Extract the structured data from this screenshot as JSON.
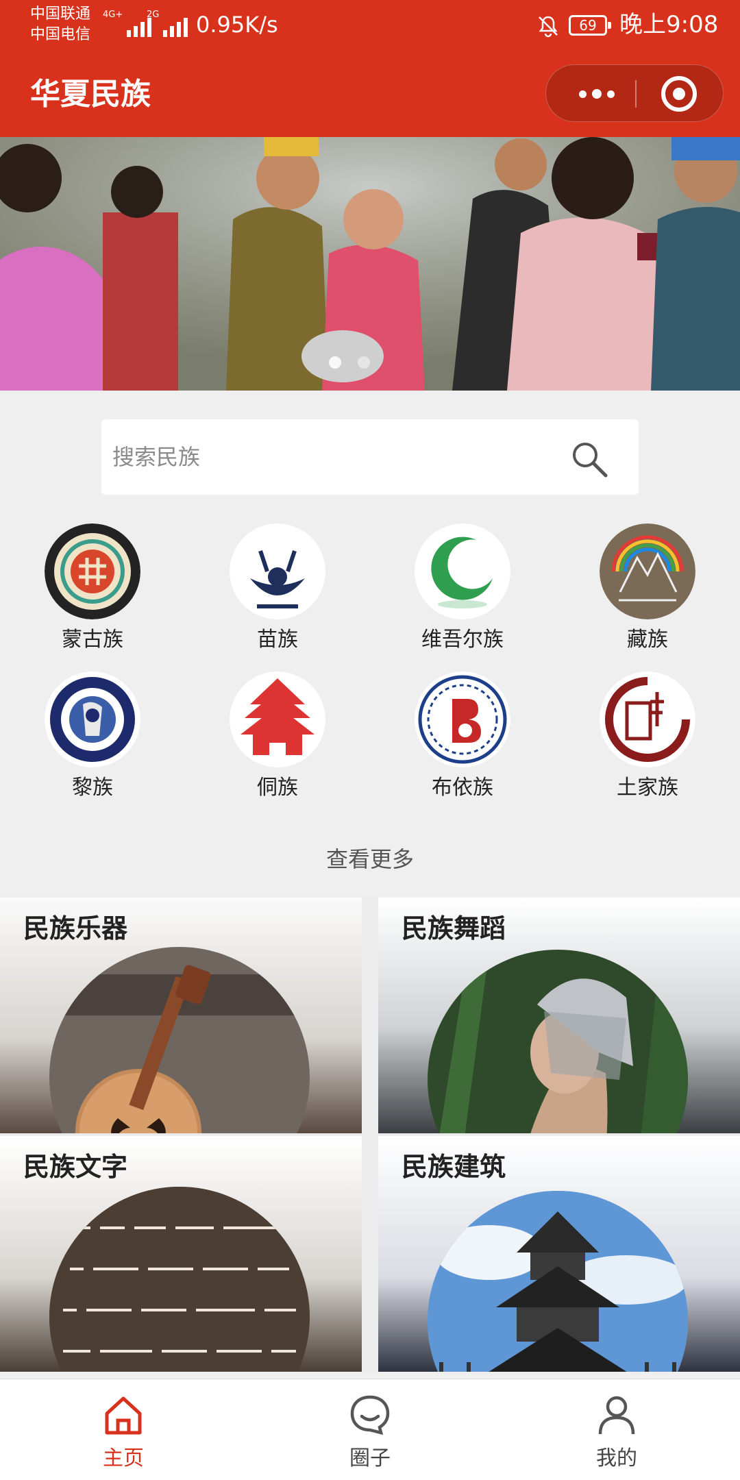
{
  "status_bar": {
    "carrier_1": "中国联通",
    "carrier_2": "中国电信",
    "signal_1_tag": "4G+",
    "signal_2_tag": "2G",
    "net_speed": "0.95K/s",
    "battery": "69",
    "time": "晚上9:08"
  },
  "header": {
    "title": "华夏民族",
    "more_icon": "more-dots-icon",
    "close_icon": "target-close-icon"
  },
  "banner": {
    "slide_count": 2,
    "active_index": 0
  },
  "search": {
    "placeholder": "搜索民族",
    "value": ""
  },
  "ethnic_groups": [
    {
      "name": "蒙古族",
      "icon": "mongol-emblem-icon"
    },
    {
      "name": "苗族",
      "icon": "miao-emblem-icon"
    },
    {
      "name": "维吾尔族",
      "icon": "uyghur-emblem-icon"
    },
    {
      "name": "藏族",
      "icon": "tibetan-emblem-icon"
    },
    {
      "name": "黎族",
      "icon": "li-emblem-icon"
    },
    {
      "name": "侗族",
      "icon": "dong-emblem-icon"
    },
    {
      "name": "布依族",
      "icon": "buyi-emblem-icon"
    },
    {
      "name": "土家族",
      "icon": "tujia-emblem-icon"
    }
  ],
  "more_link": "查看更多",
  "categories": [
    {
      "title": "民族乐器"
    },
    {
      "title": "民族舞蹈"
    },
    {
      "title": "民族文字"
    },
    {
      "title": "民族建筑"
    }
  ],
  "tabbar": {
    "tabs": [
      {
        "label": "主页",
        "icon": "home-icon",
        "active": true
      },
      {
        "label": "圈子",
        "icon": "chat-bubble-icon",
        "active": false
      },
      {
        "label": "我的",
        "icon": "user-icon",
        "active": false
      }
    ],
    "active_color": "#d9321c"
  },
  "colors": {
    "brand": "#d9321c",
    "page_bg": "#efefef"
  }
}
